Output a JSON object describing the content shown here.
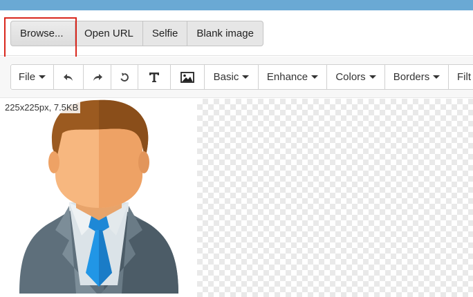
{
  "source_buttons": [
    "Browse...",
    "Open URL",
    "Selfie",
    "Blank image"
  ],
  "toolbar": {
    "file": "File",
    "basic": "Basic",
    "enhance": "Enhance",
    "colors": "Colors",
    "borders": "Borders",
    "filters": "Filt"
  },
  "icons": [
    "undo-icon",
    "redo-icon",
    "reset-icon",
    "text-icon",
    "image-icon"
  ],
  "image_info": "225x225px, 7.5KB",
  "colors": {
    "top_strip": "#6aa9d4",
    "highlight": "#d9261c"
  }
}
